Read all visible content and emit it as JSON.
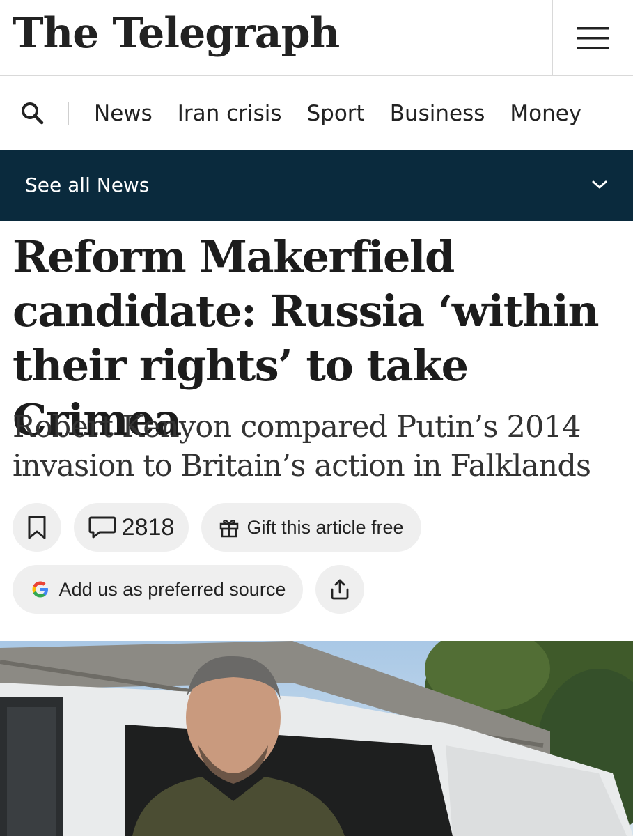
{
  "header": {
    "logo_text": "The Telegraph",
    "menu_icon": "hamburger-menu-icon"
  },
  "nav": {
    "search_icon": "search-icon",
    "items": [
      "News",
      "Iran crisis",
      "Sport",
      "Business",
      "Money"
    ]
  },
  "section_bar": {
    "label": "See all News",
    "chevron_icon": "chevron-down-icon"
  },
  "article": {
    "headline": "Reform Makerfield candidate: Russia ‘within their rights’ to take Crimea",
    "standfirst": "Robert Kenyon compared Putin’s 2014 invasion to Britain’s action in Falklands",
    "actions": {
      "comment_count": "2818",
      "gift_label": "Gift this article free",
      "preferred_source_label": "Add us as preferred source"
    }
  },
  "colors": {
    "section_bar_bg": "#0a2a3d",
    "pill_bg": "#efefef",
    "text": "#1c1c1c"
  }
}
